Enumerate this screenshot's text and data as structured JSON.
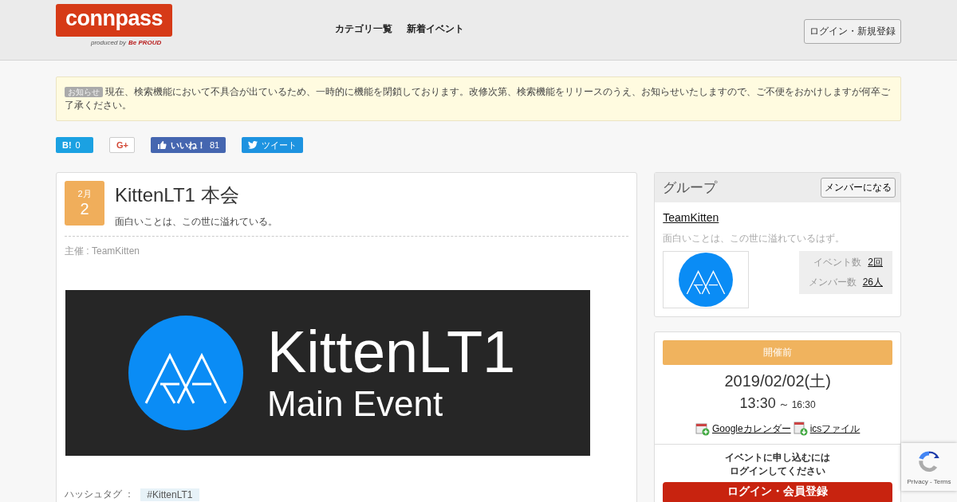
{
  "header": {
    "logo": {
      "name": "connpass",
      "produced_by": "produced by",
      "maker": "Be PROUD"
    },
    "nav": [
      "カテゴリ一覧",
      "新着イベント"
    ],
    "login_button": "ログイン・新規登録"
  },
  "notice": {
    "badge": "お知らせ",
    "text": "現在、検索機能において不具合が出ているため、一時的に機能を閉鎖しております。改修次第、検索機能をリリースのうえ、お知らせいたしますので、ご不便をおかけしますが何卒ご了承ください。"
  },
  "share": [
    {
      "kind": "hatena",
      "label": "B!",
      "count": "0"
    },
    {
      "kind": "gplus",
      "label": "G+"
    },
    {
      "kind": "facebook",
      "label": "いいね！",
      "count": "81"
    },
    {
      "kind": "twitter",
      "label": "ツイート"
    }
  ],
  "event": {
    "month": "2月",
    "day": "2",
    "title": "KittenLT1 本会",
    "catch": "面白いことは、この世に溢れている。",
    "organizer": "主催 : TeamKitten",
    "banner": {
      "title": "KittenLT1",
      "subtitle": "Main Event"
    },
    "hashtag_label": "ハッシュタグ ：",
    "hashtag": "#KittenLT1"
  },
  "group": {
    "heading": "グループ",
    "join_button": "メンバーになる",
    "name": "TeamKitten",
    "description": "面白いことは、この世に溢れているはず。",
    "stats": [
      {
        "label": "イベント数",
        "value": "2回"
      },
      {
        "label": "メンバー数",
        "value": "26人"
      }
    ]
  },
  "schedule": {
    "status": "開催前",
    "date": "2019/02/02(土)",
    "start": "13:30",
    "separator": "～",
    "end": "16:30",
    "links": [
      {
        "kind": "google",
        "label": "Googleカレンダー"
      },
      {
        "kind": "ics",
        "label": "icsファイル"
      }
    ],
    "apply_note": [
      "イベントに申し込むには",
      "ログインしてください"
    ],
    "apply_button": "ログイン・会員登録"
  },
  "recaptcha": {
    "text": "Privacy - Terms"
  }
}
